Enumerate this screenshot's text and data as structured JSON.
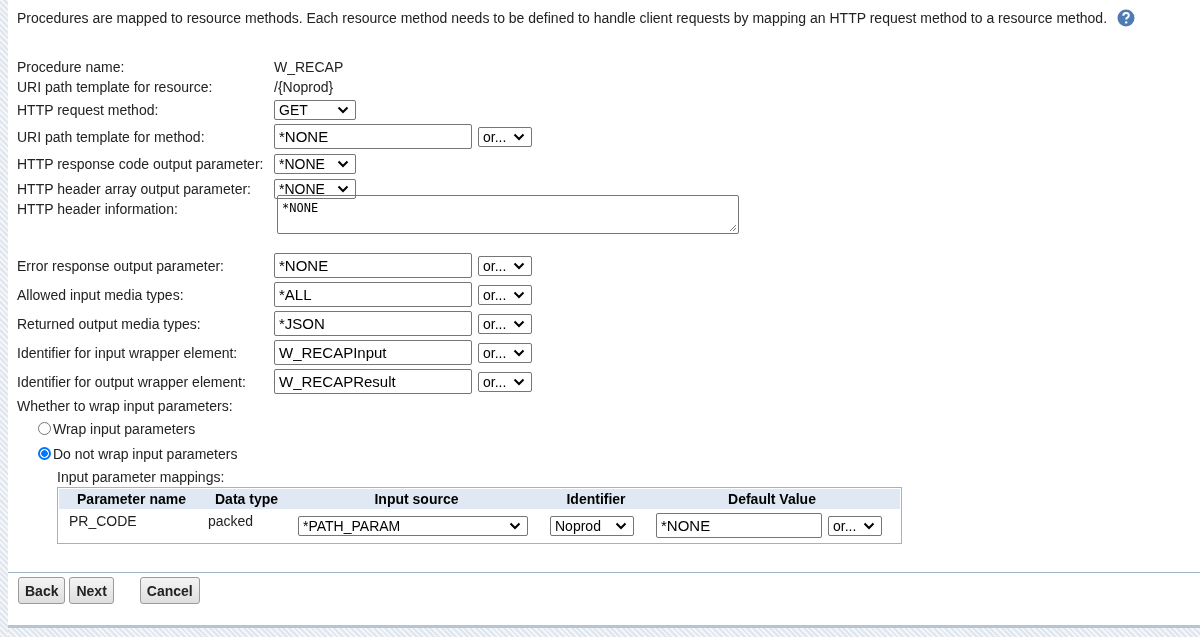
{
  "intro": "Procedures are mapped to resource methods. Each resource method needs to be defined to handle client requests by mapping an HTTP request method to a resource method.",
  "fields": [
    {
      "kind": "text",
      "label": "Procedure name:",
      "value": "W_RECAP"
    },
    {
      "kind": "text",
      "label": "URI path template for resource:",
      "value": "/{Noprod}"
    },
    {
      "kind": "select",
      "label": "HTTP request method:",
      "value": "GET"
    },
    {
      "kind": "input",
      "label": "URI path template for method:",
      "value": "*NONE",
      "option": "or..."
    },
    {
      "kind": "select",
      "label": "HTTP response code output parameter:",
      "value": "*NONE"
    },
    {
      "kind": "select",
      "label": "HTTP header array output parameter:",
      "value": "*NONE"
    },
    {
      "kind": "textarea",
      "label": "HTTP header information:",
      "value": "*NONE"
    },
    {
      "kind": "input",
      "label": "Error response output parameter:",
      "value": "*NONE",
      "option": "or..."
    },
    {
      "kind": "input",
      "label": "Allowed input media types:",
      "value": "*ALL",
      "option": "or..."
    },
    {
      "kind": "input",
      "label": "Returned output media types:",
      "value": "*JSON",
      "option": "or..."
    },
    {
      "kind": "input",
      "label": "Identifier for input wrapper element:",
      "value": "W_RECAPInput",
      "option": "or..."
    },
    {
      "kind": "input",
      "label": "Identifier for output wrapper element:",
      "value": "W_RECAPResult",
      "option": "or..."
    }
  ],
  "wrap": {
    "label": "Whether to wrap input parameters:",
    "options": [
      {
        "label": "Wrap input parameters",
        "selected": false
      },
      {
        "label": "Do not wrap input parameters",
        "selected": true
      }
    ]
  },
  "mappings": {
    "label": "Input parameter mappings:",
    "columns": [
      "Parameter name",
      "Data type",
      "Input source",
      "Identifier",
      "Default Value"
    ],
    "rows": [
      {
        "name": "PR_CODE",
        "type": "packed",
        "source": "*PATH_PARAM",
        "identifier": "Noprod",
        "default": "*NONE",
        "option": "or..."
      }
    ]
  },
  "buttons": [
    "Back",
    "Next",
    "Cancel"
  ]
}
